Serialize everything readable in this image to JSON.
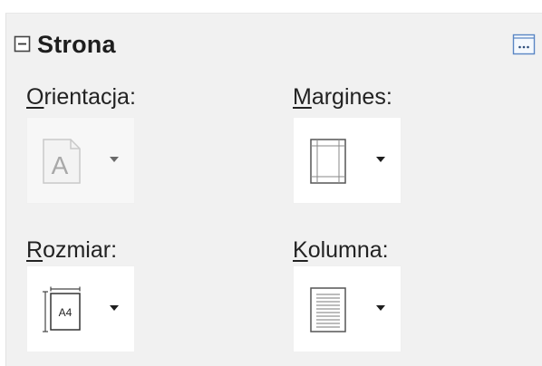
{
  "panel": {
    "title": "Strona",
    "collapse_icon": "minus-box-icon",
    "more_icon": "ellipsis-box-icon"
  },
  "groups": [
    {
      "label_accel": "O",
      "label_rest": "rientacja:",
      "icon": "orientation-icon",
      "enabled": false
    },
    {
      "label_accel": "M",
      "label_rest": "argines:",
      "icon": "margins-icon",
      "enabled": true
    },
    {
      "label_accel": "R",
      "label_rest": "ozmiar:",
      "icon": "page-size-icon",
      "enabled": true,
      "icon_text": "A4"
    },
    {
      "label_accel": "K",
      "label_rest": "olumna:",
      "icon": "columns-icon",
      "enabled": true
    }
  ],
  "orientation_icon_letter": "A",
  "colors": {
    "panel_bg": "#f1f1f1",
    "button_bg": "#ffffff",
    "accent": "#3c6fb0"
  }
}
